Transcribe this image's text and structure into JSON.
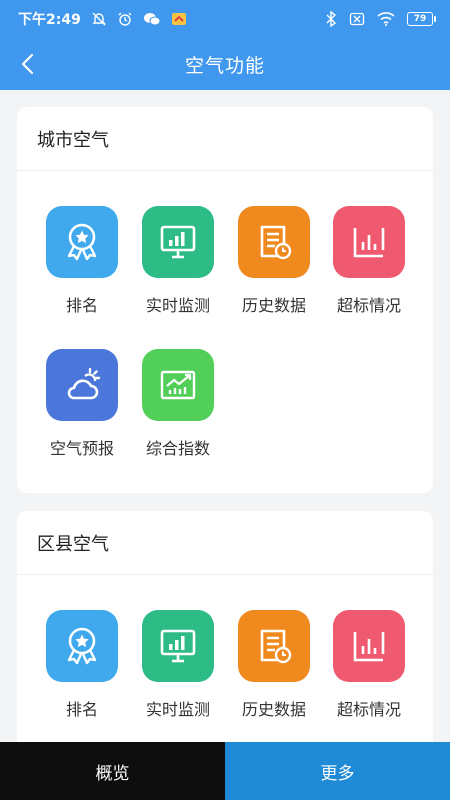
{
  "status_bar": {
    "time": "下午2:49",
    "battery": "79"
  },
  "header": {
    "title": "空气功能"
  },
  "sections": [
    {
      "title": "城市空气",
      "items": [
        {
          "label": "排名",
          "icon": "ribbon-star-icon",
          "color": "#40a9ee"
        },
        {
          "label": "实时监测",
          "icon": "monitor-bar-chart-icon",
          "color": "#2ebc86"
        },
        {
          "label": "历史数据",
          "icon": "document-clock-icon",
          "color": "#f08a1e"
        },
        {
          "label": "超标情况",
          "icon": "bar-chart-frame-icon",
          "color": "#ef5a70"
        },
        {
          "label": "空气预报",
          "icon": "sun-cloud-icon",
          "color": "#4a77d9"
        },
        {
          "label": "综合指数",
          "icon": "trend-chart-icon",
          "color": "#52cf58"
        }
      ]
    },
    {
      "title": "区县空气",
      "items": [
        {
          "label": "排名",
          "icon": "ribbon-star-icon",
          "color": "#40a9ee"
        },
        {
          "label": "实时监测",
          "icon": "monitor-bar-chart-icon",
          "color": "#2ebc86"
        },
        {
          "label": "历史数据",
          "icon": "document-clock-icon",
          "color": "#f08a1e"
        },
        {
          "label": "超标情况",
          "icon": "bar-chart-frame-icon",
          "color": "#ef5a70"
        }
      ]
    }
  ],
  "bottom_nav": {
    "overview": "概览",
    "more": "更多"
  }
}
